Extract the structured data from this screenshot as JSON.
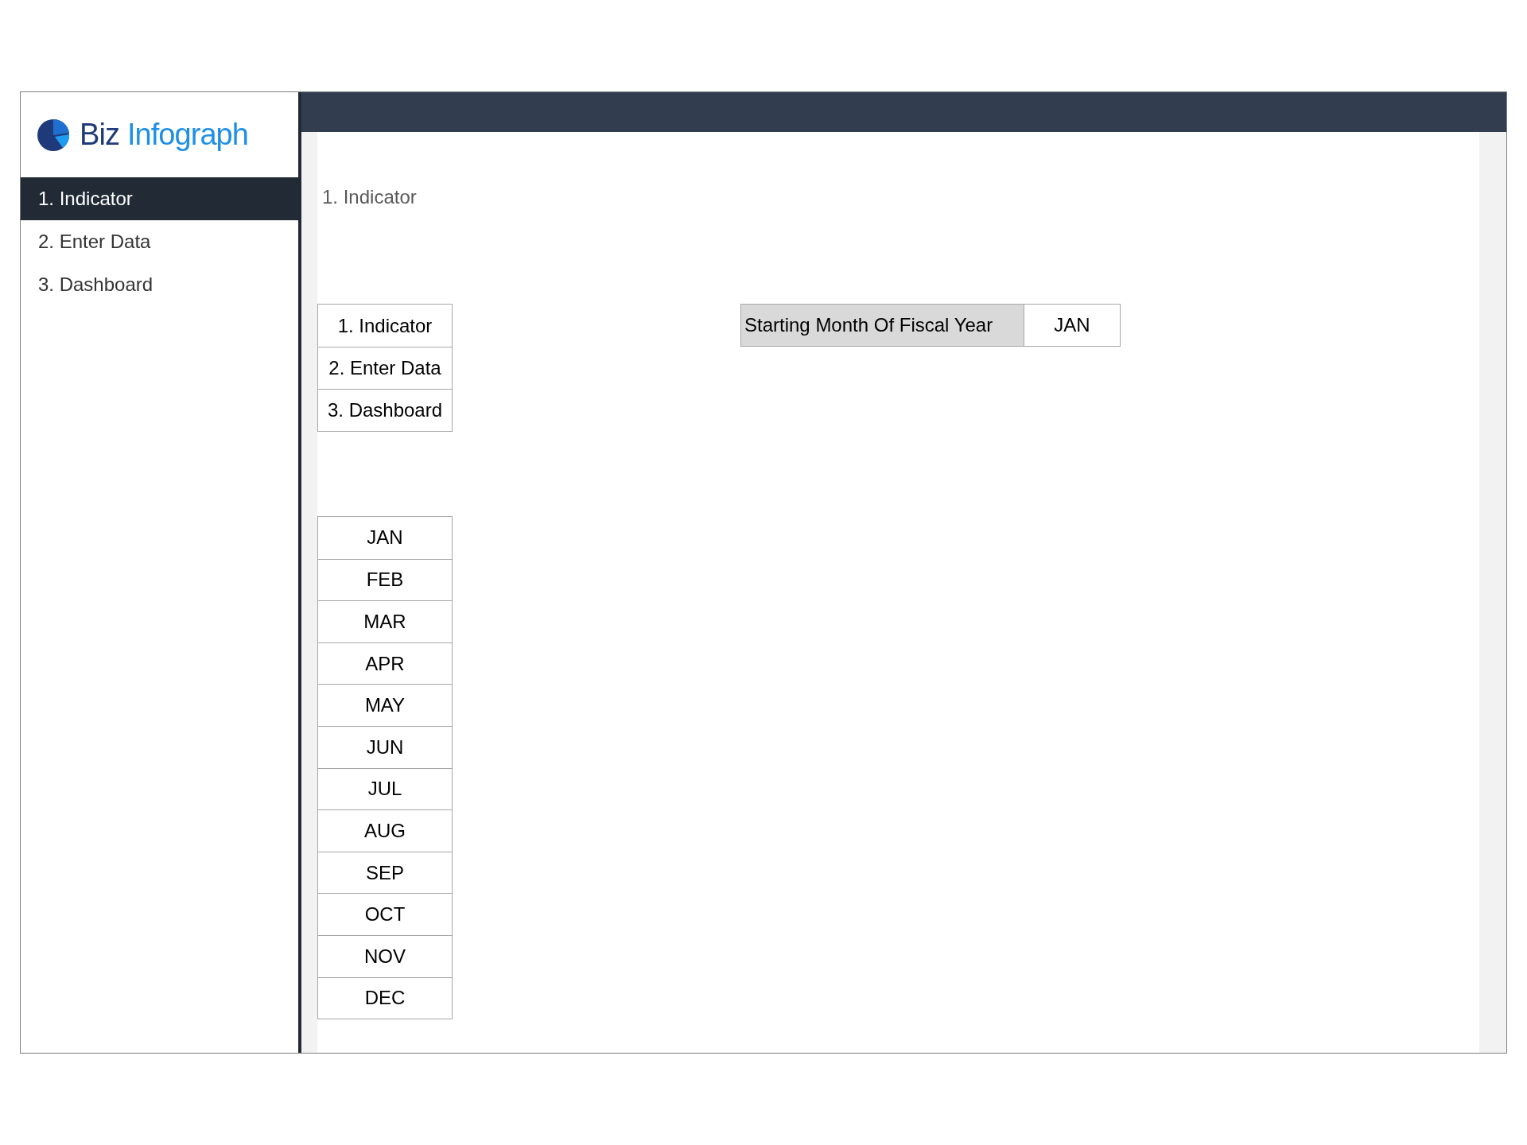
{
  "logo": {
    "word_1": "Biz",
    "word_2": "Infograph"
  },
  "sidebar": {
    "items": [
      {
        "label": "1. Indicator",
        "selected": true
      },
      {
        "label": "2. Enter Data",
        "selected": false
      },
      {
        "label": "3. Dashboard",
        "selected": false
      }
    ]
  },
  "page_title": "1. Indicator",
  "nav_table": [
    "1. Indicator",
    "2. Enter Data",
    "3. Dashboard"
  ],
  "fiscal_setting": {
    "label": "Starting Month Of Fiscal Year",
    "value": "JAN"
  },
  "months": [
    "JAN",
    "FEB",
    "MAR",
    "APR",
    "MAY",
    "JUN",
    "JUL",
    "AUG",
    "SEP",
    "OCT",
    "NOV",
    "DEC"
  ]
}
